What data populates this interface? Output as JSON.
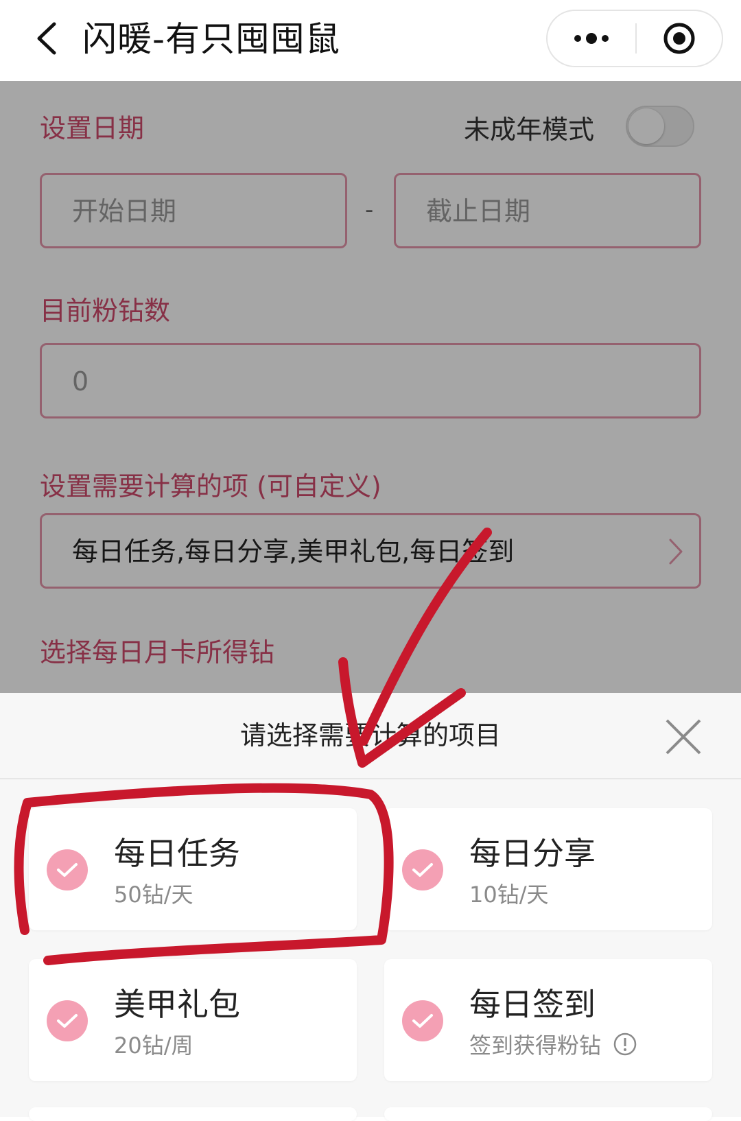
{
  "navbar": {
    "title": "闪暖-有只囤囤鼠",
    "back_icon": "chevron-left-icon",
    "more_icon": "more-dots-icon",
    "close_icon": "target-circle-icon"
  },
  "form": {
    "date_section_label": "设置日期",
    "minor_mode_label": "未成年模式",
    "minor_mode_on": false,
    "start_date_placeholder": "开始日期",
    "date_separator": "-",
    "end_date_placeholder": "截止日期",
    "current_diamonds_label": "目前粉钻数",
    "current_diamonds_value": "0",
    "items_section_label": "设置需要计算的项 (可自定义)",
    "items_selected_value": "每日任务,每日分享,美甲礼包,每日签到",
    "monthly_card_label": "选择每日月卡所得钻"
  },
  "sheet": {
    "title": "请选择需要计算的项目",
    "close_icon": "close-x-icon",
    "options": [
      {
        "name": "每日任务",
        "sub": "50钻/天",
        "checked": true
      },
      {
        "name": "每日分享",
        "sub": "10钻/天",
        "checked": true
      },
      {
        "name": "美甲礼包",
        "sub": "20钻/周",
        "checked": true
      },
      {
        "name": "每日签到",
        "sub": "签到获得粉钻",
        "checked": true
      }
    ]
  },
  "colors": {
    "accent_pink": "#d04a6c",
    "field_border": "#e596ab",
    "check_fill": "#f4a0b4",
    "annotation_red": "#c8182c"
  }
}
